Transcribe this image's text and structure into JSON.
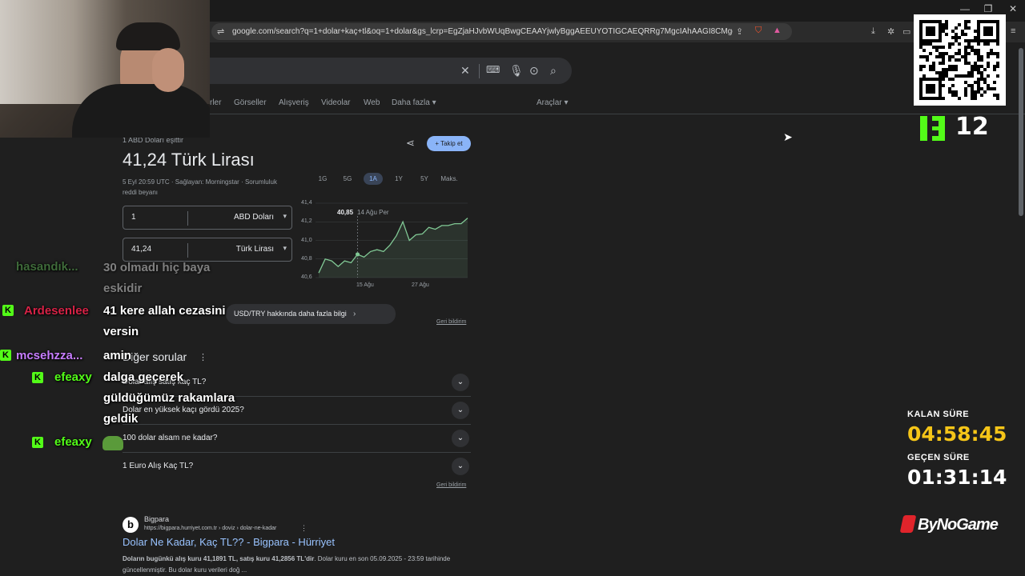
{
  "browser": {
    "url": "google.com/search?q=1+dolar+kaç+tl&oq=1+dolar&gs_lcrp=EgZjaHJvbWUqBwgCEAAYjwlyBggAEEUYOTIGCAEQRRg7MgcIAhAAGI8CMgcIAxAAGI8..."
  },
  "tabs": [
    "rler",
    "Görseller",
    "Alışveriş",
    "Videolar",
    "Web",
    "Daha fazla ▾",
    "Araçlar ▾"
  ],
  "widget": {
    "equals_label": "1 ABD Doları eşittir",
    "rate": "41,24 Türk Lirası",
    "timestamp": "5 Eyl 20:59 UTC · Sağlayan: Morningstar · Sorumluluk",
    "disclaimer": "reddi beyanı",
    "follow": "+ Takip et",
    "from_amount": "1",
    "from_currency": "ABD Doları",
    "to_amount": "41,24",
    "to_currency": "Türk Lirası",
    "periods": [
      "1G",
      "5G",
      "1A",
      "1Y",
      "5Y",
      "Maks."
    ],
    "selected_period": "1A",
    "more_info": "USD/TRY hakkında daha fazla bilgi",
    "feedback": "Geri bildirim"
  },
  "chart_data": {
    "type": "line",
    "y_ticks": [
      "41,4",
      "41,2",
      "41,0",
      "40,8",
      "40,6"
    ],
    "x_ticks": [
      "15 Ağu",
      "27 Ağu"
    ],
    "tooltip_value": "40,85",
    "tooltip_date": "14 Ağu Per",
    "ylim": [
      40.6,
      41.4
    ],
    "series": [
      {
        "values": [
          40.65,
          40.8,
          40.78,
          40.72,
          40.78,
          40.76,
          40.85,
          40.82,
          40.88,
          40.9,
          40.88,
          40.95,
          41.05,
          41.2,
          41.0,
          41.06,
          41.07,
          41.14,
          41.12,
          41.16,
          41.16,
          41.18,
          41.18,
          41.24
        ]
      }
    ]
  },
  "paa": {
    "title": "Diğer sorular",
    "questions": [
      "Dolar alış satış kaç TL?",
      "Dolar en yüksek kaçı gördü 2025?",
      "100 dolar alsam ne kadar?",
      "1 Euro Alış Kaç TL?"
    ],
    "feedback": "Geri bildirim"
  },
  "result": {
    "site": "Bigpara",
    "url": "https://bigpara.hurriyet.com.tr › doviz › dolar-ne-kadar",
    "title": "Dolar Ne Kadar, Kaç TL?? - Bigpara - Hürriyet",
    "snippet_bold": "Doların bugünkü alış kuru 41,1891 TL, satış kuru 41,2856 TL'dir",
    "snippet_rest": ". Dolar kuru en son 05.09.2025 - 23:59 tarihinde güncellenmiştir. Bu dolar kuru verileri doğ ..."
  },
  "chat": [
    {
      "user": "hasandık...",
      "color": "#3f6b3a",
      "text": "30 olmadı hiç baya eskidir",
      "badge": false
    },
    {
      "user": "Ardesenlee",
      "color": "#d62246",
      "text": "41 kere allah cezasini versin",
      "badge": true
    },
    {
      "user": "mcsehzza...",
      "color": "#c77dff",
      "text": "amin",
      "badge": true
    },
    {
      "user": "efeaxy",
      "color": "#53fc18",
      "text": "dalga geçerek güldüğümüz rakamlara geldik",
      "badge": true
    },
    {
      "user": "efeaxy",
      "color": "#53fc18",
      "text": "",
      "badge": true
    }
  ],
  "overlay": {
    "viewers": "12",
    "remaining_label": "KALAN SÜRE",
    "remaining_value": "04:58:45",
    "elapsed_label": "GEÇEN SÜRE",
    "elapsed_value": "01:31:14",
    "brand": "ByNoGame",
    "accent": "#53fc18",
    "timer_color": "#f5c518"
  }
}
